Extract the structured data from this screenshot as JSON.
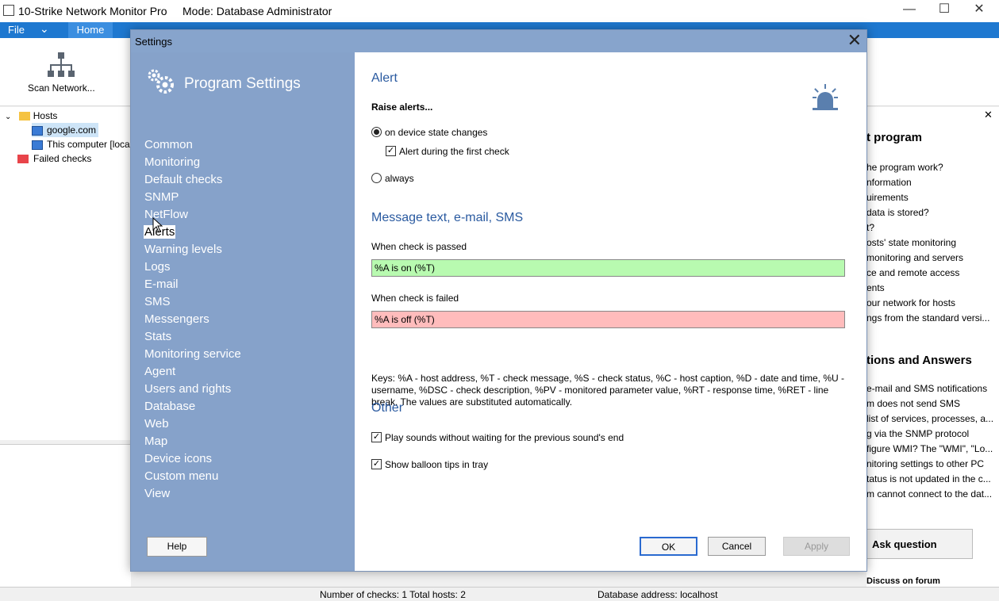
{
  "app": {
    "title": "10-Strike Network Monitor Pro",
    "mode": "Mode: Database Administrator",
    "minimize": "—",
    "maximize": "☐",
    "close": "✕"
  },
  "ribbon": {
    "file": "File",
    "file_caret": "⌄",
    "home": "Home",
    "scan_label": "Scan Network..."
  },
  "tree": {
    "root": "Hosts",
    "items": [
      "google.com",
      "This computer [loca"
    ],
    "failed": "Failed checks"
  },
  "dialog": {
    "title": "Settings",
    "close": "✕",
    "sidebar_title": "Program Settings",
    "nav": [
      "Common",
      "Monitoring",
      "Default checks",
      "SNMP",
      "NetFlow",
      "Alerts",
      "Warning levels",
      "Logs",
      "E-mail",
      "SMS",
      "Messengers",
      "Stats",
      "Monitoring service",
      "Agent",
      "Users and rights",
      "Database",
      "Web",
      "Map",
      "Device icons",
      "Custom menu",
      "View"
    ],
    "active_nav": "Alerts",
    "help": "Help",
    "alert": {
      "heading": "Alert",
      "raise": "Raise alerts...",
      "opt_state": "on device state changes",
      "first_check": "Alert during the first check",
      "opt_always": "always",
      "selected": "on device state changes",
      "first_check_checked": true
    },
    "message": {
      "heading": "Message text, e-mail, SMS",
      "passed_label": "When check is passed",
      "passed_value": "%A is on (%T)",
      "passed_color": "#b8fab0",
      "failed_label": "When check is failed",
      "failed_value": "%A is off (%T)",
      "failed_color": "#ffbcbc",
      "keys": "Keys: %A - host address, %T - check message, %S - check status, %C - host caption, %D - date and time, %U - username, %DSC - check description, %PV - monitored parameter value, %RT - response time, %RET - line break. The values are substituted automatically."
    },
    "other": {
      "heading": "Other",
      "play_sounds": "Play sounds without waiting for the previous sound's end",
      "balloon": "Show balloon tips in tray",
      "play_sounds_checked": true,
      "balloon_checked": true
    },
    "ok": "OK",
    "cancel": "Cancel",
    "apply": "Apply"
  },
  "right_panel": {
    "heading1": "t program",
    "links1": [
      "he program work?",
      "nformation",
      "uirements",
      "data is stored?",
      "t?",
      "osts' state monitoring",
      "monitoring and servers",
      "ce and remote access",
      "ents",
      "our network for hosts",
      "ngs from the standard versi..."
    ],
    "heading2": "tions and Answers",
    "links2": [
      "e-mail and SMS notifications",
      "m does not send SMS",
      "list of services, processes, a...",
      "g via the SNMP protocol",
      "figure WMI? The \"WMI\", \"Lo...",
      "nitoring settings to other PC",
      "tatus is not updated in the c...",
      "m cannot connect to the dat..."
    ],
    "ask": "Ask question",
    "forum": "Discuss on forum",
    "close": "✕"
  },
  "status": {
    "checks": "Number of checks: 1  Total hosts: 2",
    "db": "Database address: localhost"
  },
  "icons": {
    "gear": "gear-icon",
    "alert": "siren-icon",
    "folder": "folder-icon",
    "host": "computer-icon"
  }
}
